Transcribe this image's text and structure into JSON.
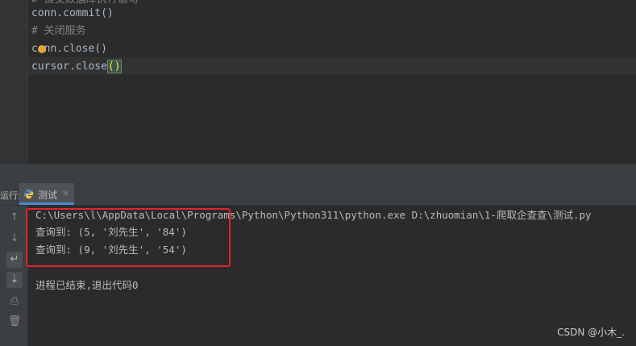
{
  "editor": {
    "lines": [
      {
        "text": "# 提交数据库执行语句"
      },
      {
        "text": "conn.commit()"
      },
      {
        "text": "# 关闭服务"
      },
      {
        "text": "conn.close()"
      },
      {
        "text": "cursor.close",
        "paren": "()"
      }
    ]
  },
  "run_window": {
    "label": "运行:",
    "tab_label": "测试",
    "tab_close": "×"
  },
  "toolbar": {
    "up_icon": "↑",
    "down_icon": "↓",
    "wrap_icon": "↵",
    "scroll_end_icon": "⇣",
    "print_icon": "⎙",
    "trash_icon": "🗑"
  },
  "console": {
    "lines": [
      "C:\\Users\\l\\AppData\\Local\\Programs\\Python\\Python311\\python.exe D:\\zhuomian\\1-爬取企查查\\测试.py",
      "查询到: (5, '刘先生', '84')",
      "查询到: (9, '刘先生', '54')",
      "进程已结束,退出代码0"
    ]
  },
  "watermark": "CSDN @小木_.",
  "colors": {
    "editor_bg": "#2b2b2b",
    "panel_bg": "#3c3f41",
    "highlight_box": "#e5222c",
    "tab_underline": "#4a88c7"
  }
}
